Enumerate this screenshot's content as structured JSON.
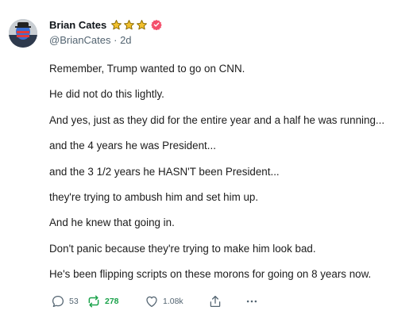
{
  "post": {
    "author": {
      "display_name": "Brian Cates",
      "handle": "@BrianCates",
      "time_ago": "2d",
      "badges": [
        "star-icon",
        "star-icon",
        "star-icon",
        "verified-badge-icon"
      ],
      "colors": {
        "star": "#f2c12e",
        "verified": "#f44f6b"
      }
    },
    "lines": [
      "Remember, Trump wanted to go on CNN.",
      "He did not do this lightly.",
      "And yes, just as they did for the entire year and a half he was running...",
      "and the 4 years he was President...",
      "and the 3 1/2 years he HASN'T been President...",
      "they're trying to ambush him and set him up.",
      "And he knew that going in.",
      "Don't panic because they're trying to make him look bad.",
      "He's been flipping scripts on these morons for going on 8 years now."
    ],
    "actions": {
      "reply": {
        "icon": "comment-icon",
        "count": "53"
      },
      "repost": {
        "icon": "repost-icon",
        "count": "278",
        "color": "#1aa24a"
      },
      "like": {
        "icon": "heart-icon",
        "count": "1.08k"
      },
      "share": {
        "icon": "share-icon"
      },
      "more": {
        "icon": "more-icon"
      }
    }
  }
}
